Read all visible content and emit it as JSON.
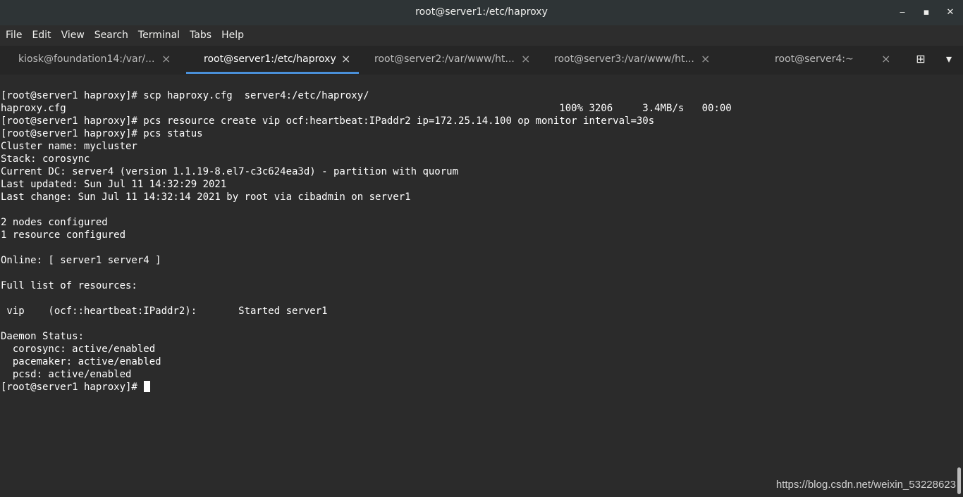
{
  "window": {
    "title": "root@server1:/etc/haproxy",
    "minimize": "‒",
    "maximize": "▪",
    "close": "✕"
  },
  "menu": [
    "File",
    "Edit",
    "View",
    "Search",
    "Terminal",
    "Tabs",
    "Help"
  ],
  "tabs": [
    {
      "label": "kiosk@foundation14:/var/...",
      "active": false
    },
    {
      "label": "root@server1:/etc/haproxy",
      "active": true
    },
    {
      "label": "root@server2:/var/www/ht...",
      "active": false
    },
    {
      "label": "root@server3:/var/www/ht...",
      "active": false
    },
    {
      "label": "root@server4:~",
      "active": false
    }
  ],
  "tab_close": "×",
  "tab_icons": {
    "new_tab": "⊞",
    "dropdown": "▾"
  },
  "terminal_lines": [
    "[root@server1 haproxy]# scp haproxy.cfg  server4:/etc/haproxy/",
    "haproxy.cfg                                                                                   100% 3206     3.4MB/s   00:00",
    "[root@server1 haproxy]# pcs resource create vip ocf:heartbeat:IPaddr2 ip=172.25.14.100 op monitor interval=30s",
    "[root@server1 haproxy]# pcs status",
    "Cluster name: mycluster",
    "Stack: corosync",
    "Current DC: server4 (version 1.1.19-8.el7-c3c624ea3d) - partition with quorum",
    "Last updated: Sun Jul 11 14:32:29 2021",
    "Last change: Sun Jul 11 14:32:14 2021 by root via cibadmin on server1",
    "",
    "2 nodes configured",
    "1 resource configured",
    "",
    "Online: [ server1 server4 ]",
    "",
    "Full list of resources:",
    "",
    " vip    (ocf::heartbeat:IPaddr2):       Started server1",
    "",
    "Daemon Status:",
    "  corosync: active/enabled",
    "  pacemaker: active/enabled",
    "  pcsd: active/enabled"
  ],
  "prompt": "[root@server1 haproxy]# ",
  "watermark": "https://blog.csdn.net/weixin_53228623"
}
